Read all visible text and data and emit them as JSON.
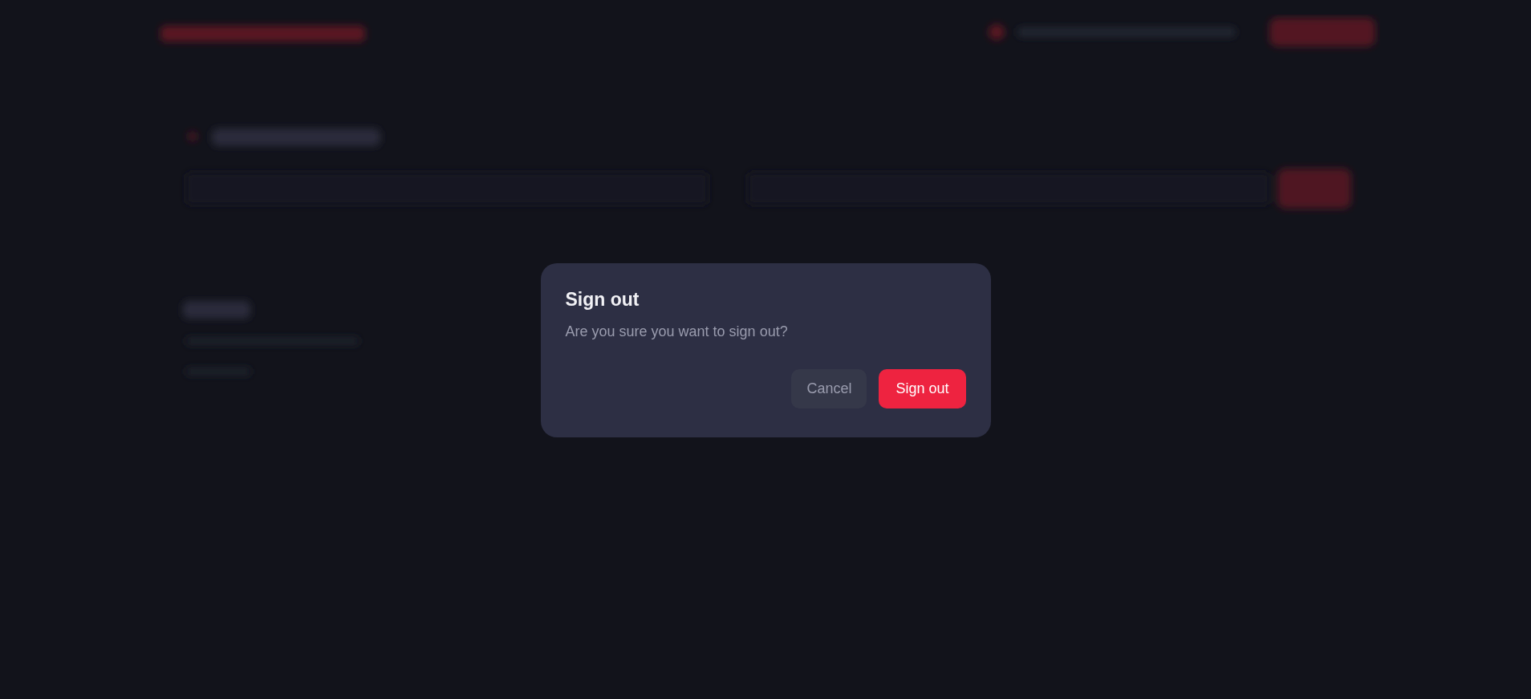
{
  "dialog": {
    "title": "Sign out",
    "message": "Are you sure you want to sign out?",
    "buttons": [
      {
        "kind": "secondary",
        "label": "Cancel"
      },
      {
        "kind": "danger",
        "label": "Sign out"
      }
    ]
  }
}
